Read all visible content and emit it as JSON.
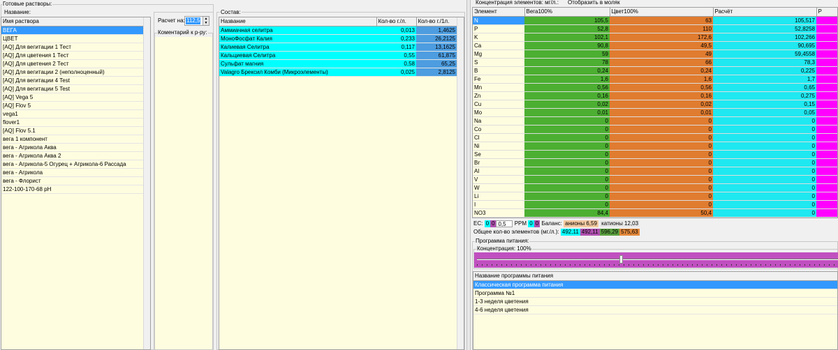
{
  "solutions": {
    "group_title": "Готовые растворы:",
    "name_label": "Название:",
    "column": "Имя раствора",
    "items": [
      "ВЕГА",
      "ЦВЕТ",
      "[AQ] Для вегитации 1 Тест",
      "[AQ] Для цветения 1 Тест",
      "[AQ] Для цветения 2 Тест",
      "[AQ] Для вегитации 2 (неполноценный)",
      "[AQ] Для вегитации 4 Test",
      "[AQ] Для вегитации 5 Test",
      "[AQ] Vega 5",
      "[AQ] Flov 5",
      "vega1",
      "flover1",
      "[AQ] Flov 5.1",
      "вега 1 компонент",
      "вега - Агрикола Аква",
      "вега - Агрикола Аква 2",
      "вега - Агрикола-5 Огурец + Агрикола-6 Рассада",
      "вега - Агрикола",
      "вега - Флорист",
      "122-100-170-68 pH"
    ],
    "selected": 0
  },
  "calc": {
    "label": "Расчет на:",
    "value": "112,5",
    "comment_label": "Коментарий к р-ру:"
  },
  "composition": {
    "title": "Состав:",
    "columns": [
      "Название",
      "Кол-во г./л.",
      "Кол-во г./1л."
    ],
    "rows": [
      [
        "Аммиачная селитра",
        "0,013",
        "1,4625"
      ],
      [
        "МоноФосфат Калия",
        "0,233",
        "26,2125"
      ],
      [
        "Калиевая Селитра",
        "0,117",
        "13,1625"
      ],
      [
        "Кальциевая Селитра",
        "0,55",
        "61,875"
      ],
      [
        "Сульфат магния",
        "0,58",
        "65,25"
      ],
      [
        "Valagro Брексил Комби (Микроэлементы)",
        "0,025",
        "2,8125"
      ]
    ]
  },
  "concentration": {
    "title": "Концентрация элементов: мг/л.:",
    "show_molar": "Отобразить в моляк",
    "columns": [
      "Элемент",
      "Вега100%",
      "Цвет100%",
      "Расчёт"
    ],
    "rows": [
      [
        "N",
        "105,5",
        "63",
        "105,517"
      ],
      [
        "P",
        "52,8",
        "110",
        "52,8258"
      ],
      [
        "K",
        "102,1",
        "172,6",
        "102,266"
      ],
      [
        "Ca",
        "90,8",
        "49,5",
        "90,695"
      ],
      [
        "Mg",
        "59",
        "49",
        "59,4558"
      ],
      [
        "S",
        "78",
        "66",
        "78,3"
      ],
      [
        "B",
        "0,24",
        "0,24",
        "0,225"
      ],
      [
        "Fe",
        "1,6",
        "1,6",
        "1,7"
      ],
      [
        "Mn",
        "0,56",
        "0,56",
        "0,65"
      ],
      [
        "Zn",
        "0,16",
        "0,16",
        "0,275"
      ],
      [
        "Cu",
        "0,02",
        "0,02",
        "0,15"
      ],
      [
        "Mo",
        "0,01",
        "0,01",
        "0,05"
      ],
      [
        "Na",
        "0",
        "0",
        "0"
      ],
      [
        "Co",
        "0",
        "0",
        "0"
      ],
      [
        "Cl",
        "0",
        "0",
        "0"
      ],
      [
        "Ni",
        "0",
        "0",
        "0"
      ],
      [
        "Se",
        "0",
        "0",
        "0"
      ],
      [
        "Br",
        "0",
        "0",
        "0"
      ],
      [
        "Al",
        "0",
        "0",
        "0"
      ],
      [
        "V",
        "0",
        "0",
        "0"
      ],
      [
        "W",
        "0",
        "0",
        "0"
      ],
      [
        "Li",
        "0",
        "0",
        "0"
      ],
      [
        "I",
        "0",
        "0",
        "0"
      ],
      [
        "NO3",
        "84,4",
        "50,4",
        "0"
      ]
    ]
  },
  "ec": {
    "label": "EC:",
    "v1": "0",
    "v2": "0",
    "v3": "0,5",
    "ppm_label": "PPM",
    "ppm1": "0",
    "ppm2": "0",
    "balance_label": "Баланс:",
    "anions": "анионы 6,59",
    "cations": "катионы 12,03"
  },
  "totals": {
    "label": "Общее кол-во элементов (мг./л.):",
    "v1": "492,11",
    "v2": "492,11",
    "v3": "596,29",
    "v4": "575,63"
  },
  "program": {
    "title": "Программа питания:",
    "conc_label": "Концентрация: 100%",
    "slider_value": 0.4,
    "column": "Название программы питания",
    "items": [
      "Классическая программа питания",
      "Программа №1",
      "1-3 неделя цветения",
      "4-6 неделя цветения"
    ],
    "selected": 0
  },
  "colors": {
    "vega": "#4caf32",
    "cvet": "#e07c30",
    "calc": "#00ffff",
    "selection": "#3399ff"
  }
}
